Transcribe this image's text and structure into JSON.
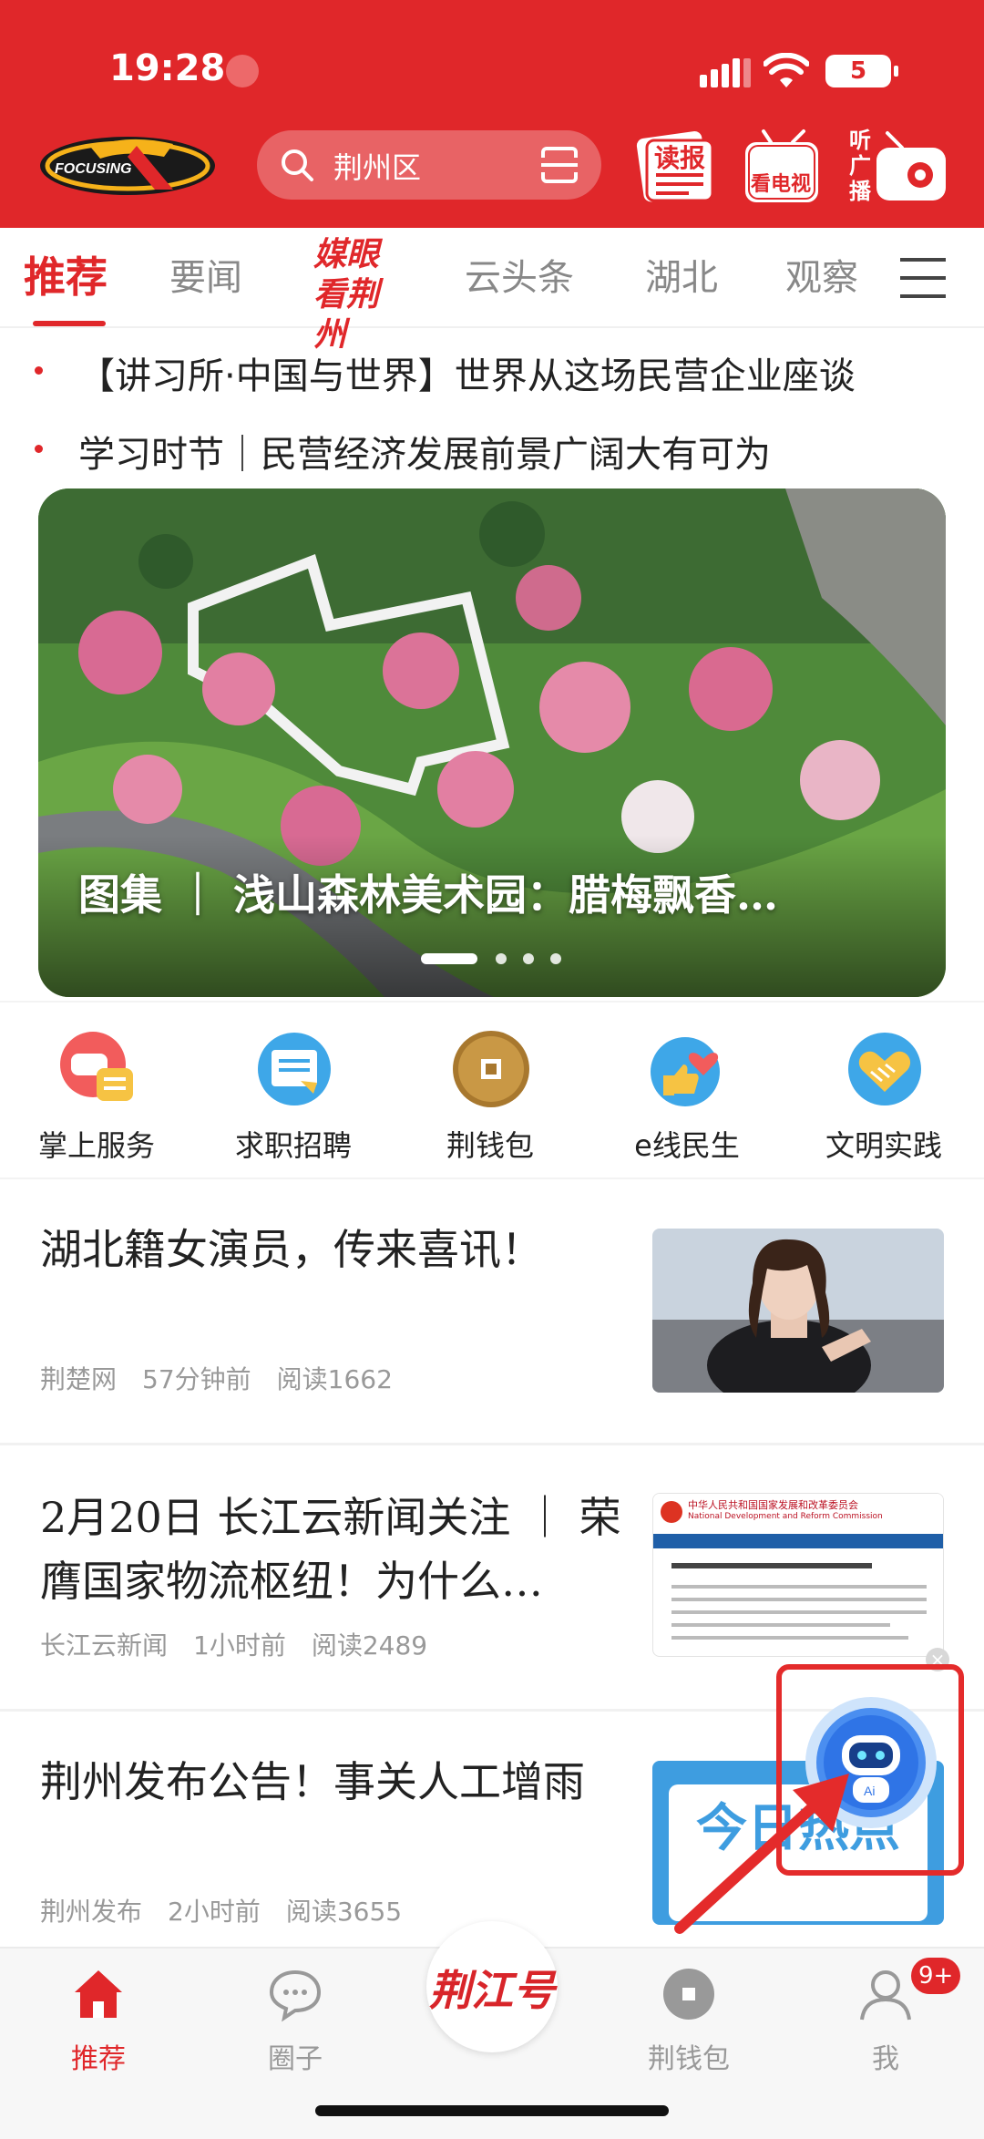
{
  "status_bar": {
    "time": "19:28",
    "battery": "5"
  },
  "header": {
    "logo_text": "FOCUSING",
    "search_placeholder": "荆州区",
    "read_paper_label": "读报",
    "watch_tv_label": "看电视",
    "listen_radio_label": "听广播",
    "accent_color": "#e0272a"
  },
  "tabs": [
    {
      "label": "推荐",
      "active": true
    },
    {
      "label": "要闻"
    },
    {
      "label": "媒眼看荆州"
    },
    {
      "label": "云头条"
    },
    {
      "label": "湖北"
    },
    {
      "label": "观察"
    }
  ],
  "headlines": [
    "【讲习所·中国与世界】世界从这场民营企业座谈",
    "学习时节｜民营经济发展前景广阔大有可为"
  ],
  "banner": {
    "caption": "图集 ｜ 浅山森林美术园：腊梅飘香…",
    "page_count": 4,
    "current_page": 1
  },
  "services": [
    {
      "label": "掌上服务",
      "icon": "chat-service-icon"
    },
    {
      "label": "求职招聘",
      "icon": "job-board-icon"
    },
    {
      "label": "荆钱包",
      "icon": "coin-wallet-icon"
    },
    {
      "label": "e线民生",
      "icon": "heart-thumb-icon"
    },
    {
      "label": "文明实践",
      "icon": "handshake-icon"
    }
  ],
  "news": [
    {
      "title": "湖北籍女演员，传来喜讯！",
      "source": "荆楚网",
      "time": "57分钟前",
      "reads": "阅读1662"
    },
    {
      "title": "2月20日 长江云新闻关注 ｜ 荣膺国家物流枢纽！为什么…",
      "source": "长江云新闻",
      "time": "1小时前",
      "reads": "阅读2489",
      "thumb_header": "中华人民共和国国家发展和改革委员会",
      "thumb_header_en": "National Development and Reform Commission"
    },
    {
      "title": "荆州发布公告！事关人工增雨",
      "source": "荆州发布",
      "time": "2小时前",
      "reads": "阅读3655",
      "thumb_text": "今日热点"
    }
  ],
  "ai_button": {
    "label": "Ai",
    "close": "×"
  },
  "bottom_nav": [
    {
      "label": "推荐",
      "active": true
    },
    {
      "label": "圈子"
    },
    {
      "label": "荆江号"
    },
    {
      "label": "荆钱包"
    },
    {
      "label": "我"
    }
  ],
  "badge": "9+"
}
